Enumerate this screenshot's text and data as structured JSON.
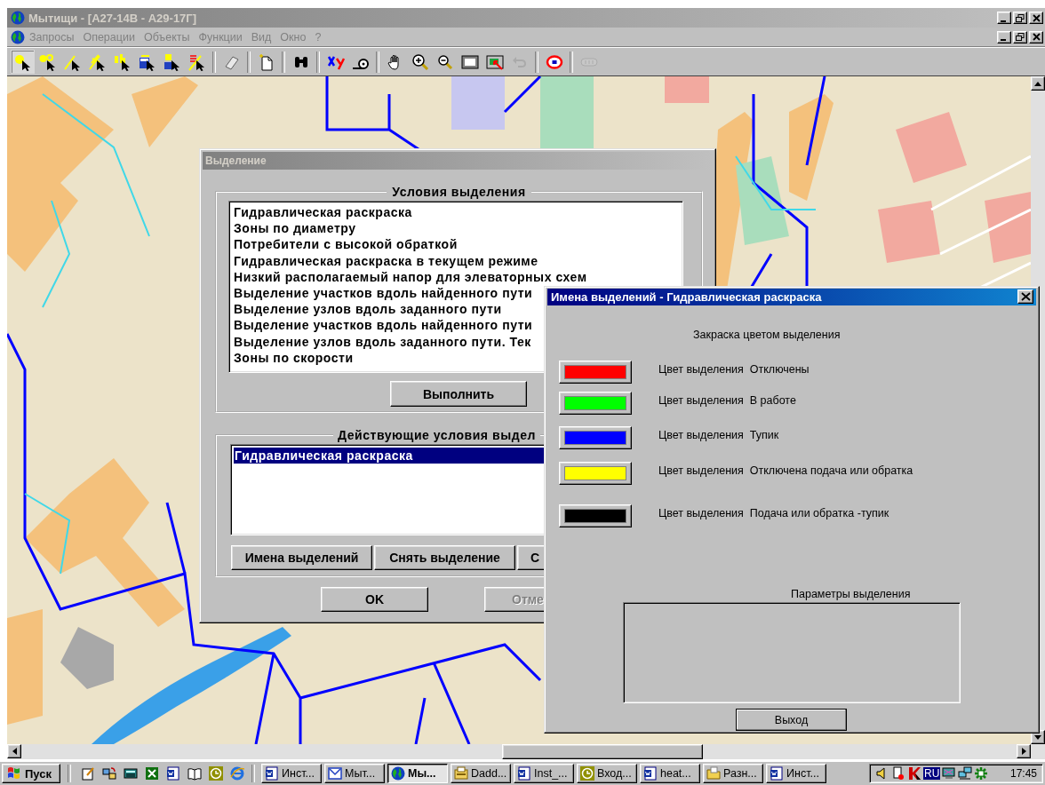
{
  "window": {
    "title": "Мытищи - [А27-14В - А29-17Г]",
    "active": false
  },
  "menu": [
    {
      "label": "Запросы",
      "disabled": true
    },
    {
      "label": "Операции",
      "disabled": true
    },
    {
      "label": "Объекты",
      "disabled": true
    },
    {
      "label": "Функции",
      "disabled": true
    },
    {
      "label": "Вид",
      "disabled": true
    },
    {
      "label": "Окно",
      "disabled": true
    },
    {
      "label": "?",
      "disabled": true
    }
  ],
  "toolbar": {
    "groups": [
      {
        "buttons": [
          {
            "kind": "point",
            "pressed": true,
            "disabled": false
          },
          {
            "kind": "point-label",
            "pressed": false,
            "disabled": false
          },
          {
            "kind": "line",
            "pressed": false,
            "disabled": false
          },
          {
            "kind": "star-line",
            "pressed": false,
            "disabled": false
          },
          {
            "kind": "text",
            "pressed": false,
            "disabled": false
          },
          {
            "kind": "box",
            "pressed": false,
            "disabled": false
          },
          {
            "kind": "label-box",
            "pressed": false,
            "disabled": false
          },
          {
            "kind": "multi-line",
            "pressed": false,
            "disabled": false
          }
        ]
      },
      {
        "buttons": [
          {
            "kind": "eraser",
            "pressed": false,
            "disabled": false
          }
        ]
      },
      {
        "buttons": [
          {
            "kind": "new-document",
            "pressed": false,
            "disabled": false
          }
        ]
      },
      {
        "buttons": [
          {
            "kind": "binoculars",
            "pressed": false,
            "disabled": false
          }
        ]
      },
      {
        "buttons": [
          {
            "kind": "axes",
            "pressed": false,
            "disabled": false
          },
          {
            "kind": "tape",
            "pressed": false,
            "disabled": false
          }
        ]
      },
      {
        "buttons": [
          {
            "kind": "hand",
            "pressed": false,
            "disabled": false
          },
          {
            "kind": "zoom-in",
            "pressed": false,
            "disabled": false
          },
          {
            "kind": "zoom-out",
            "pressed": false,
            "disabled": false
          },
          {
            "kind": "frame",
            "pressed": false,
            "disabled": false
          },
          {
            "kind": "map-pointer",
            "pressed": false,
            "disabled": false
          },
          {
            "kind": "undo",
            "pressed": false,
            "disabled": true
          }
        ]
      },
      {
        "buttons": [
          {
            "kind": "target",
            "pressed": false,
            "disabled": false
          }
        ]
      },
      {
        "buttons": [
          {
            "kind": "chain",
            "pressed": false,
            "disabled": true
          }
        ]
      }
    ]
  },
  "selection_dialog": {
    "title": "Выделение",
    "active": false,
    "conditions": {
      "title": "Условия выделения",
      "items": [
        {
          "label": "Гидравлическая раскраска",
          "selected": false
        },
        {
          "label": "Зоны по диаметру",
          "selected": false
        },
        {
          "label": "Потребители с высокой обраткой",
          "selected": false
        },
        {
          "label": "Гидравлическая раскраска в текущем режиме",
          "selected": false
        },
        {
          "label": "Низкий располагаемый напор для элеваторных схем",
          "selected": false
        },
        {
          "label": "Выделение участков вдоль найденного пути",
          "selected": false
        },
        {
          "label": "Выделение узлов вдоль заданного пути",
          "selected": false
        },
        {
          "label": "Выделение участков вдоль найденного пути",
          "selected": false
        },
        {
          "label": "Выделение узлов вдоль заданного пути. Тек",
          "selected": false
        },
        {
          "label": "Зоны по скорости",
          "selected": false
        }
      ]
    },
    "run_button": "Выполнить",
    "active_conditions": {
      "title": "Действующие условия выдел",
      "items": [
        {
          "label": "Гидравлическая раскраска",
          "selected": true
        }
      ]
    },
    "buttons": [
      {
        "label": "Имена выделений"
      },
      {
        "label": "Снять выделение"
      },
      {
        "label": "С"
      }
    ],
    "ok_button": {
      "label": "OK",
      "disabled": false
    },
    "cancel_button": {
      "label": "Отме",
      "disabled": true
    }
  },
  "names_dialog": {
    "title": "Имена выделений - Гидравлическая раскраска",
    "active": true,
    "heading": "Закраска цветом выделения",
    "colors": [
      {
        "label": "Цвет выделения  Отключены",
        "color": "#ff0000"
      },
      {
        "label": "Цвет выделения  В работе",
        "color": "#00ff00"
      },
      {
        "label": "Цвет выделения  Тупик",
        "color": "#0000ff"
      },
      {
        "label": "Цвет выделения  Отключена подача или обратка",
        "color": "#ffff00"
      },
      {
        "label": "Цвет выделения  Подача или обратка -тупик",
        "color": "#000000"
      }
    ],
    "params_label": "Параметры выделения",
    "exit_button": "Выход"
  },
  "taskbar": {
    "start": "Пуск",
    "quick_launch": [
      {
        "kind": "notepad"
      },
      {
        "kind": "sync"
      },
      {
        "kind": "calculator"
      },
      {
        "kind": "spreadsheet"
      },
      {
        "kind": "word"
      },
      {
        "kind": "book"
      },
      {
        "kind": "clock"
      },
      {
        "kind": "browser"
      }
    ],
    "tasks": [
      {
        "label": "Инст...",
        "kind": "word",
        "selected": false
      },
      {
        "label": "Мыт...",
        "kind": "mail",
        "selected": false
      },
      {
        "label": "Мы...",
        "kind": "globe",
        "selected": true
      },
      {
        "label": "Dadd...",
        "kind": "card",
        "selected": false
      },
      {
        "label": "Inst_...",
        "kind": "word",
        "selected": false
      },
      {
        "label": "Вход...",
        "kind": "clock",
        "selected": false
      },
      {
        "label": "heat...",
        "kind": "word",
        "selected": false
      },
      {
        "label": "Разн...",
        "kind": "folder",
        "selected": false
      },
      {
        "label": "Инст...",
        "kind": "word",
        "selected": false
      }
    ],
    "tray": {
      "icons": [
        {
          "kind": "speaker"
        },
        {
          "kind": "device"
        },
        {
          "kind": "antivirus"
        }
      ],
      "language": "RU",
      "icons_after": [
        {
          "kind": "monitor"
        },
        {
          "kind": "network"
        },
        {
          "kind": "snowflake"
        }
      ],
      "clock": "17:45"
    }
  }
}
